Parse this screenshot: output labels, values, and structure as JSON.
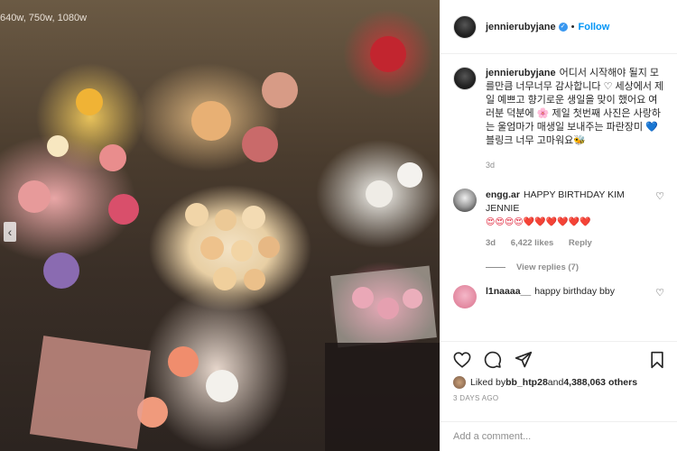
{
  "photo": {
    "watermark": "640w, 750w, 1080w",
    "prev_arrow": "‹"
  },
  "header": {
    "username": "jennierubyjane",
    "separator": "•",
    "follow_label": "Follow"
  },
  "caption": {
    "username": "jennierubyjane",
    "text": "어디서 시작해야 될지 모를만큼 너무너무 감사합니다 ♡ 세상에서 제일 예쁘고 향기로운 생일을 맞이 했어요 여러분 덕분에 🌸 제일 첫번째 사진은 사랑하는 울엄마가 매생일 보내주는 파란장미 💙 블링크 너무 고마워요🐝",
    "time": "3d"
  },
  "comments": [
    {
      "username": "engg.ar",
      "text": "HAPPY BIRTHDAY KIM JENNIE",
      "emojis": "😍😍😍😍❤️❤️❤️❤️❤️❤️",
      "time": "3d",
      "likes": "6,422 likes",
      "reply": "Reply",
      "view_replies": "View replies (7)"
    },
    {
      "username": "l1naaaa__",
      "text": "happy birthday bby"
    }
  ],
  "actions": {
    "liked_by_prefix": "Liked by ",
    "liked_by_user": "bb_htp28",
    "liked_by_and": " and ",
    "liked_by_count": "4,388,063 others",
    "date": "3 DAYS AGO"
  },
  "add_comment": {
    "placeholder": "Add a comment..."
  },
  "colors": {
    "link_blue": "#0095f6",
    "heart_red": "#e0243a",
    "muted": "#8e8e8e"
  }
}
